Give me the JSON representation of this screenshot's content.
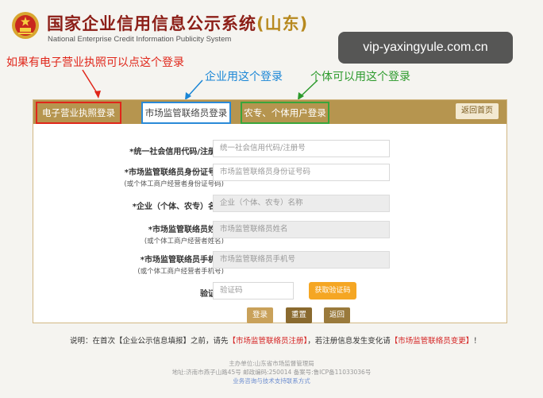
{
  "header": {
    "title_main": "国家企业信用信息公示系统",
    "title_province": "(山东)",
    "subtitle": "National Enterprise Credit Information Publicity System"
  },
  "watermark": "vip-yaxingyule.com.cn",
  "annotations": {
    "license": "如果有电子营业执照可以点这个登录",
    "enterprise": "企业用这个登录",
    "individual": "个体可以用这个登录"
  },
  "tabs": {
    "license": "电子营业执照登录",
    "liaison": "市场监管联络员登录",
    "farmer": "农专、个体用户登录",
    "back_home": "返回首页"
  },
  "form": {
    "credit_code": {
      "label": "*统一社会信用代码/注册号",
      "placeholder": "统一社会信用代码/注册号"
    },
    "id_number": {
      "label": "*市场监管联络员身份证号码",
      "note": "(或个体工商户经营者身份证号码)",
      "placeholder": "市场监管联络员身份证号码"
    },
    "company_name": {
      "label": "*企业（个体、农专）名称",
      "placeholder": "企业（个体、农专）名称"
    },
    "liaison_name": {
      "label": "*市场监管联络员姓名",
      "note": "(或个体工商户经营者姓名)",
      "placeholder": "市场监管联络员姓名"
    },
    "phone": {
      "label": "*市场监管联络员手机号",
      "note": "(或个体工商户经营者手机号)",
      "placeholder": "市场监管联络员手机号"
    },
    "captcha": {
      "label": "验证码",
      "placeholder": "验证码",
      "button": "获取验证码"
    }
  },
  "buttons": {
    "login": "登录",
    "reset": "重置",
    "back": "返回"
  },
  "note": {
    "prefix": "说明：在首次【企业公示信息填报】之前，请先",
    "link1": "【市场监管联络员注册】",
    "middle": "，若注册信息发生变化请",
    "link2": "【市场监管联络员变更】",
    "suffix": "！"
  },
  "footer": {
    "line1": "主办单位:山东省市场监督管理局",
    "line2": "地址:济南市燕子山路45号    邮政编码:250014    备案号:鲁ICP备11033036号",
    "line3": "业务咨询与技术支持联系方式"
  },
  "colors": {
    "tab_bar": "#b6954f",
    "title_red": "#8c1e17",
    "annotation_red": "#e0261a",
    "annotation_blue": "#1a86d6",
    "annotation_green": "#2c9a2c"
  }
}
